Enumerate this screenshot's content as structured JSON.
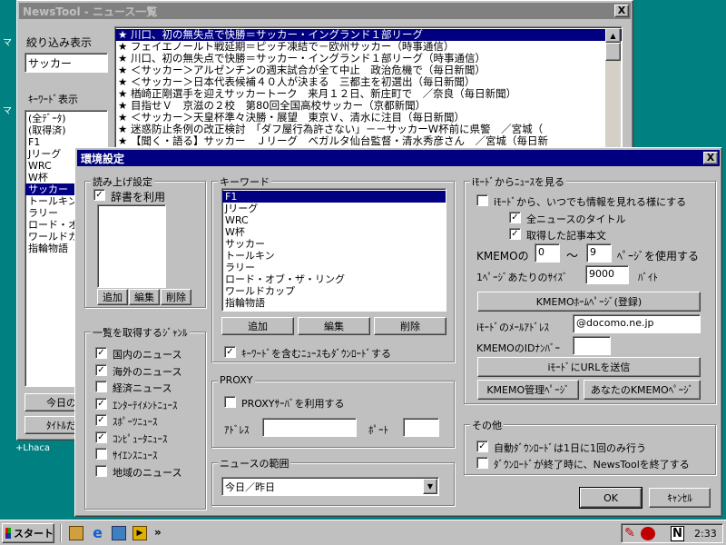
{
  "desktop": {
    "left_labels": [
      "マ",
      "マ"
    ],
    "lhaca_label": "+Lhaca"
  },
  "main_window": {
    "title": "NewsTool - ニュース一覧",
    "close": "X",
    "filter_heading": "絞り込み表示",
    "filter_value": "サッカー",
    "keyword_heading": "ｷｰﾜｰﾄﾞ表示",
    "keyword_items": [
      "(全ﾃﾞｰﾀ)",
      "(取得済)",
      "F1",
      "Jリーグ",
      "WRC",
      "W杯",
      "サッカー",
      "トールキン",
      "ラリー",
      "ロード・オブ",
      "ワールドカ",
      "指輪物語"
    ],
    "keyword_selected": 6,
    "button_today": "今日のニ",
    "button_title": "ﾀｲﾄﾙだけ",
    "news": [
      "★ 川口、初の無失点で快勝＝サッカー・イングランド１部リーグ",
      "★ フェイエノールト戦延期＝ピッチ凍結で－欧州サッカー（時事通信）",
      "★ 川口、初の無失点で快勝＝サッカー・イングランド１部リーグ（時事通信）",
      "★ ＜サッカー＞アルゼンチンの週末試合が全て中止　政治危機で（毎日新聞）",
      "★ ＜サッカー＞日本代表候補４０人が決まる　三都主を初選出（毎日新聞）",
      "★ 楢崎正剛選手を迎えサッカートーク　来月１２日、新庄町で　／奈良（毎日新聞）",
      "★ 目指せＶ　京滋の２校　第80回全国高校サッカー（京都新聞）",
      "★ ＜サッカー＞天皇杯準々決勝・展望　東京Ｖ、清水に注目（毎日新聞）",
      "★ 迷惑防止条例の改正検討　「ダフ屋行為許さない」－－サッカーW杯前に県警　／宮城（",
      "★ 【聞く・語る】サッカー　Ｊリーグ　ベガルタ仙台監督・清水秀彦さん　／宮城（毎日新"
    ],
    "news_selected": 0
  },
  "dialog": {
    "title": "環境設定",
    "close": "X",
    "readout": {
      "label": "読み上げ設定",
      "use_dict_label": "辞書を利用",
      "use_dict_checked": true,
      "add": "追加",
      "edit": "編集",
      "delete": "削除"
    },
    "genres": {
      "label": "一覧を取得するｼﾞｬﾝﾙ",
      "items": [
        {
          "label": "国内のニュース",
          "checked": true
        },
        {
          "label": "海外のニュース",
          "checked": true
        },
        {
          "label": "経済ニュース",
          "checked": false
        },
        {
          "label": "ｴﾝﾀｰﾃｲﾒﾝﾄﾆｭｰｽ",
          "checked": true
        },
        {
          "label": "ｽﾎﾟｰﾂﾆｭｰｽ",
          "checked": true
        },
        {
          "label": "ｺﾝﾋﾟｭｰﾀﾆｭｰｽ",
          "checked": true
        },
        {
          "label": "ｻｲｴﾝｽﾆｭｰｽ",
          "checked": false
        },
        {
          "label": "地域のニュース",
          "checked": false
        }
      ]
    },
    "keywords": {
      "label": "キーワード",
      "items": [
        "F1",
        "Jリーグ",
        "WRC",
        "W杯",
        "サッカー",
        "トールキン",
        "ラリー",
        "ロード・オブ・ザ・リング",
        "ワールドカップ",
        "指輪物語"
      ],
      "selected": 0,
      "add": "追加",
      "edit": "編集",
      "delete": "削除",
      "download_label": "ｷｰﾜｰﾄﾞを含むﾆｭｰｽもﾀﾞｳﾝﾛｰﾄﾞする",
      "download_checked": true
    },
    "proxy": {
      "label": "PROXY",
      "use_label": "PROXYｻｰﾊﾞを利用する",
      "use_checked": false,
      "address_label": "ｱﾄﾞﾚｽ",
      "address_value": "",
      "port_label": "ﾎﾟｰﾄ",
      "port_value": ""
    },
    "range": {
      "label": "ニュースの範囲",
      "value": "今日／昨日"
    },
    "imode": {
      "label": "iﾓｰﾄﾞからﾆｭｰｽを見る",
      "enable_label": "iﾓｰﾄﾞから、いつでも情報を見れる様にする",
      "enable_checked": false,
      "all_titles_label": "全ニュースのタイトル",
      "all_titles_checked": true,
      "article_label": "取得した記事本文",
      "article_checked": true,
      "kmemo_label": "KMEMOの",
      "page_from": "0",
      "tilde": "～",
      "page_to": "9",
      "page_suffix": "ﾍﾟｰｼﾞを使用する",
      "size_label": "1ﾍﾟｰｼﾞあたりのｻｲｽﾞ",
      "size_value": "9000",
      "size_unit": "ﾊﾞｲﾄ",
      "homepage_button": "KMEMOﾎｰﾑﾍﾟｰｼﾞ(登録)",
      "mail_label": "iﾓｰﾄﾞのﾒｰﾙｱﾄﾞﾚｽ",
      "mail_value": "@docomo.ne.jp",
      "id_label": "KMEMOのIDﾅﾝﾊﾞｰ",
      "id_value": "",
      "send_url_button": "iﾓｰﾄﾞにURLを送信",
      "admin_button": "KMEMO管理ﾍﾟｰｼﾞ",
      "your_button": "あなたのKMEMOﾍﾟｰｼﾞ"
    },
    "other": {
      "label": "その他",
      "auto_dl_label": "自動ﾀﾞｳﾝﾛｰﾄﾞは1日に1回のみ行う",
      "auto_dl_checked": true,
      "exit_label": "ﾀﾞｳﾝﾛｰﾄﾞが終了時に、NewsToolを終了する",
      "exit_checked": false
    },
    "ok": "OK",
    "cancel": "ｷｬﾝｾﾙ"
  },
  "taskbar": {
    "start": "スタート",
    "chevron": "»",
    "tray_n": "N",
    "clock": "2:33"
  }
}
